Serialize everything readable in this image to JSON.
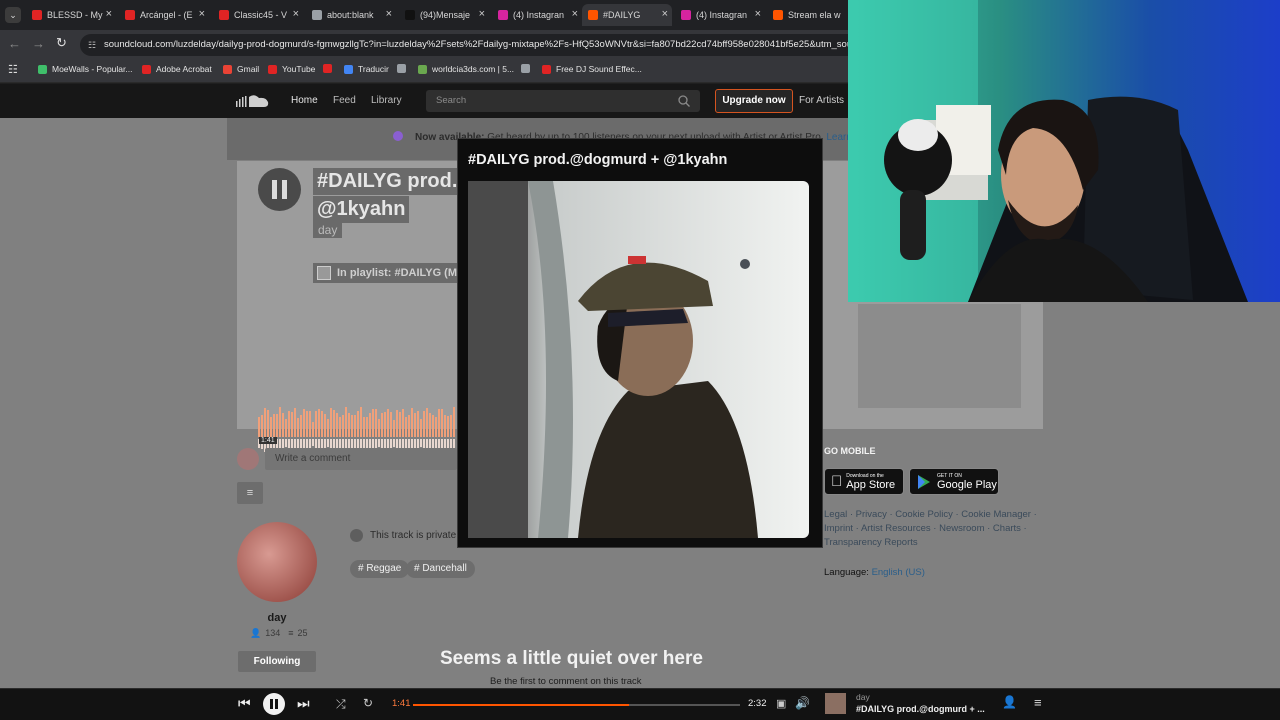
{
  "tabs": [
    {
      "label": "BLESSD - My",
      "fav": "#e02424",
      "active": false
    },
    {
      "label": "Arcángel - (E",
      "fav": "#e02424",
      "active": false
    },
    {
      "label": "Classic45 - V",
      "fav": "#e02424",
      "active": false
    },
    {
      "label": "about:blank",
      "fav": "#9aa0a6",
      "active": false
    },
    {
      "label": "(94)Mensaje",
      "fav": "#111111",
      "active": false
    },
    {
      "label": "(4) Instagran",
      "fav": "#d6249f",
      "active": false
    },
    {
      "label": "#DAILYG",
      "fav": "#ff5500",
      "active": true
    },
    {
      "label": "(4) Instagran",
      "fav": "#d6249f",
      "active": false
    },
    {
      "label": "Stream ela w",
      "fav": "#ff5500",
      "active": false
    }
  ],
  "address": {
    "url": "soundcloud.com/luzdelday/dailyg-prod-dogmurd/s-fgmwgzllgTc?in=luzdelday%2Fsets%2Fdailyg-mixtape%2Fs-HfQ53oWNVtr&si=fa807bd22cd74bff958e028041bf5e25&utm_sour"
  },
  "bookmarks": [
    {
      "label": "MoeWalls - Popular...",
      "color": "#3fbf6a"
    },
    {
      "label": "Adobe Acrobat",
      "color": "#e02424"
    },
    {
      "label": "Gmail",
      "color": "#ea4335"
    },
    {
      "label": "YouTube",
      "color": "#e02424"
    },
    {
      "label": "",
      "color": "#e02424"
    },
    {
      "label": "Traducir",
      "color": "#4285f4"
    },
    {
      "label": "",
      "color": "#9aa0a6"
    },
    {
      "label": "worldcia3ds.com | 5...",
      "color": "#6aa84f"
    },
    {
      "label": "",
      "color": "#9aa0a6"
    },
    {
      "label": "Free DJ Sound Effec...",
      "color": "#e02424"
    }
  ],
  "header": {
    "home": "Home",
    "feed": "Feed",
    "library": "Library",
    "search_placeholder": "Search",
    "upgrade": "Upgrade now",
    "for_artists": "For Artists"
  },
  "banner": {
    "bold": "Now available:",
    "text": "Get heard by up to 100 listeners on your next upload with Artist or Artist Pro.",
    "link": "Learn"
  },
  "track": {
    "title_line1": "#DAILYG prod.@",
    "title_line2": "@1kyahn",
    "artist": "day",
    "playlist": "In playlist: #DAILYG (M",
    "waveform_time": "1:41"
  },
  "popup": {
    "title": "#DAILYG prod.@dogmurd + @1kyahn"
  },
  "comment": {
    "placeholder": "Write a comment"
  },
  "private_note": "This track is private",
  "tags": [
    "# Reggae",
    "# Dancehall"
  ],
  "uploader": {
    "name": "day",
    "followers": "134",
    "tracks": "25",
    "follow_label": "Following"
  },
  "empty": {
    "title": "Seems a little quiet over here",
    "subtitle": "Be the first to comment on this track"
  },
  "sidebar": {
    "go_mobile": "GO MOBILE",
    "app_store_small": "Download on the",
    "app_store": "App Store",
    "google_small": "GET IT ON",
    "google": "Google Play",
    "footer_line1": "Legal · Privacy · Cookie Policy · Cookie Manager ·",
    "footer_line2": "Imprint · Artist Resources · Newsroom · Charts ·",
    "footer_line3": "Transparency Reports",
    "language_label": "Language:",
    "language_value": "English (US)"
  },
  "player": {
    "elapsed": "1:41",
    "duration": "2:32",
    "progress": 0.66,
    "artist": "day",
    "title": "#DAILYG prod.@dogmurd + ..."
  },
  "colors": {
    "accent": "#ff5500",
    "link": "#4f9bd9"
  }
}
